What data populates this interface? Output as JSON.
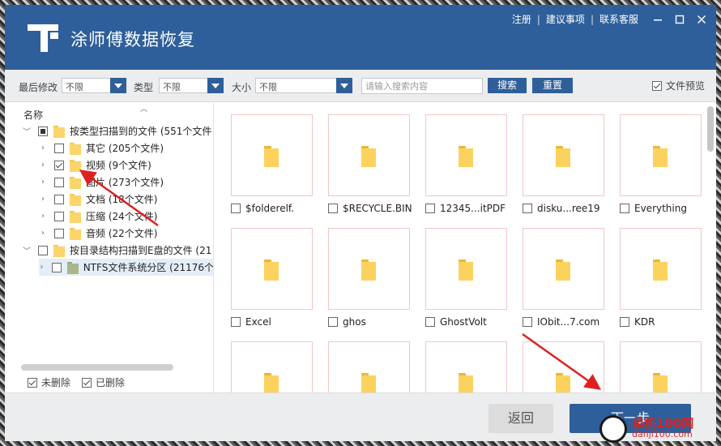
{
  "app": {
    "title": "涂师傅数据恢复",
    "links": [
      "注册",
      "建议事项",
      "联系客服"
    ]
  },
  "filters": {
    "modified_label": "最后修改",
    "modified_value": "不限",
    "type_label": "类型",
    "type_value": "不限",
    "size_label": "大小",
    "size_value": "不限",
    "search_placeholder": "请输入搜索内容",
    "search_button": "搜索",
    "reset_button": "重置",
    "preview_label": "文件预览",
    "preview_checked": true
  },
  "tree": {
    "header": "名称",
    "root1": {
      "label": "按类型扫描到的文件 (551个文件",
      "state": "partial",
      "expanded": true
    },
    "children": [
      {
        "label": "其它 (205个文件)",
        "checked": false
      },
      {
        "label": "视频 (9个文件)",
        "checked": true
      },
      {
        "label": "图片 (273个文件)",
        "checked": false
      },
      {
        "label": "文档 (18个文件)",
        "checked": false
      },
      {
        "label": "压缩 (24个文件)",
        "checked": false
      },
      {
        "label": "音频 (22个文件)",
        "checked": false
      }
    ],
    "root2": {
      "label": "按目录结构扫描到E盘的文件 (21",
      "checked": false,
      "expanded": true
    },
    "drive": {
      "label": "NTFS文件系统分区 (21176个",
      "checked": false
    },
    "bottom": {
      "undeleted": "未删除",
      "deleted": "已删除"
    }
  },
  "files": [
    {
      "name": "$folderelf."
    },
    {
      "name": "$RECYCLE.BIN"
    },
    {
      "name": "12345...itPDF"
    },
    {
      "name": "disku...ree19"
    },
    {
      "name": "Everything"
    },
    {
      "name": "Excel"
    },
    {
      "name": "ghos"
    },
    {
      "name": "GhostVolt"
    },
    {
      "name": "IObit...7.com"
    },
    {
      "name": "KDR"
    },
    {
      "name": ""
    },
    {
      "name": ""
    },
    {
      "name": ""
    },
    {
      "name": ""
    },
    {
      "name": ""
    }
  ],
  "footer": {
    "back_button": "返回",
    "next_button": "下一步"
  },
  "watermark": {
    "line1": "单机100网",
    "line2": "danji100.com"
  },
  "colors": {
    "brand_blue": "#2e5f9a",
    "annotation_red": "#e02020"
  }
}
